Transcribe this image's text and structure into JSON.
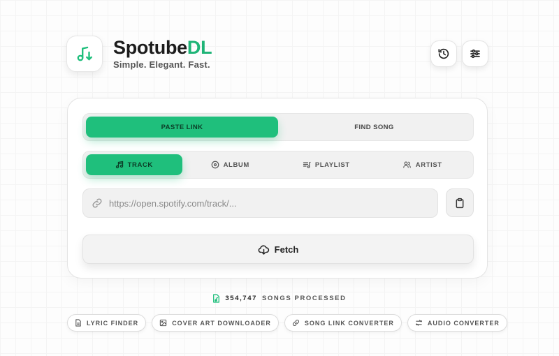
{
  "brand": {
    "name_main": "Spotube",
    "name_accent": "DL",
    "tagline": "Simple. Elegant. Fast.",
    "accent_color": "#1fbf7c"
  },
  "header": {
    "history_icon": "history-icon",
    "settings_icon": "sliders-icon"
  },
  "mode_tabs": [
    {
      "label": "PASTE LINK",
      "active": true
    },
    {
      "label": "FIND SONG",
      "active": false
    }
  ],
  "type_tabs": [
    {
      "label": "TRACK",
      "icon": "music-note-icon",
      "active": true
    },
    {
      "label": "ALBUM",
      "icon": "disc-icon",
      "active": false
    },
    {
      "label": "PLAYLIST",
      "icon": "playlist-icon",
      "active": false
    },
    {
      "label": "ARTIST",
      "icon": "users-icon",
      "active": false
    }
  ],
  "url_input": {
    "placeholder": "https://open.spotify.com/track/...",
    "value": ""
  },
  "fetch_label": "Fetch",
  "stats": {
    "count": "354,747",
    "suffix": "SONGS PROCESSED"
  },
  "tools": [
    {
      "label": "LYRIC FINDER",
      "icon": "document-icon"
    },
    {
      "label": "COVER ART DOWNLOADER",
      "icon": "image-icon"
    },
    {
      "label": "SONG LINK CONVERTER",
      "icon": "link-icon"
    },
    {
      "label": "AUDIO CONVERTER",
      "icon": "convert-icon"
    }
  ]
}
